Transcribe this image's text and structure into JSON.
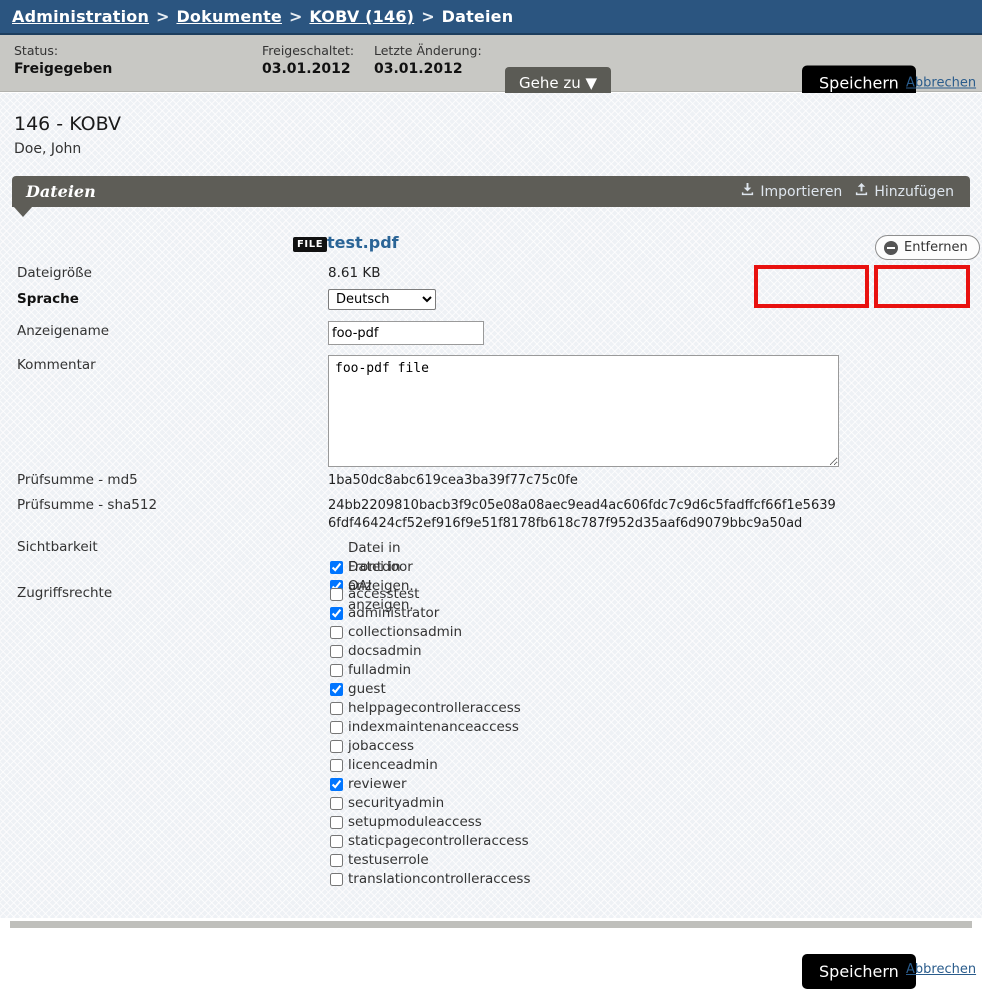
{
  "breadcrumb": {
    "items": [
      {
        "label": "Administration",
        "link": true
      },
      {
        "label": "Dokumente",
        "link": true
      },
      {
        "label": "KOBV (146)",
        "link": true
      },
      {
        "label": "Dateien",
        "link": false
      }
    ],
    "separator": ">"
  },
  "statusbar": {
    "status_label": "Status:",
    "status_value": "Freigegeben",
    "published_label": "Freigeschaltet:",
    "published_value": "03.01.2012",
    "modified_label": "Letzte Änderung:",
    "modified_value": "03.01.2012",
    "goto_label": "Gehe zu ▼",
    "save_label": "Speichern",
    "cancel_label": "Abbrechen"
  },
  "document": {
    "title": "146 - KOBV",
    "author": "Doe, John"
  },
  "section": {
    "title": "Dateien",
    "import_label": "Importieren",
    "import_icon": "download-tray-icon",
    "add_label": "Hinzufügen",
    "add_icon": "upload-tray-icon"
  },
  "file": {
    "badge": "FILE",
    "name": "test.pdf",
    "remove_label": "Entfernen",
    "remove_icon": "minus-circle-icon"
  },
  "form": {
    "filesize_label": "Dateigröße",
    "filesize_value": "8.61 KB",
    "language_label": "Sprache",
    "language_value": "Deutsch",
    "language_options": [
      "Deutsch"
    ],
    "displayname_label": "Anzeigename",
    "displayname_value": "foo-pdf",
    "displayname_placeholder": "",
    "comment_label": "Kommentar",
    "comment_value": "foo-pdf file",
    "comment_placeholder": "",
    "md5_label": "Prüfsumme - md5",
    "md5_value": "1ba50dc8abc619cea3ba39f77c75c0fe",
    "sha512_label": "Prüfsumme - sha512",
    "sha512_value": "24bb2209810bacb3f9c05e08a08aec9ead4ac606fdc7c9d6c5fadffcf66f1e5639\n6fdf46424cf52ef916f9e51f8178fb618c787f952d35aaf6d9079bbc9a50ad",
    "visibility_label": "Sichtbarkeit",
    "visibility_options": [
      {
        "label": "Datei in Frontdoor anzeigen.",
        "checked": true
      },
      {
        "label": "Datei in OAI anzeigen.",
        "checked": true
      }
    ],
    "access_label": "Zugriffsrechte",
    "access_options": [
      {
        "label": "accesstest",
        "checked": false
      },
      {
        "label": "administrator",
        "checked": true
      },
      {
        "label": "collectionsadmin",
        "checked": false
      },
      {
        "label": "docsadmin",
        "checked": false
      },
      {
        "label": "fulladmin",
        "checked": false
      },
      {
        "label": "guest",
        "checked": true
      },
      {
        "label": "helppagecontrolleraccess",
        "checked": false
      },
      {
        "label": "indexmaintenanceaccess",
        "checked": false
      },
      {
        "label": "jobaccess",
        "checked": false
      },
      {
        "label": "licenceadmin",
        "checked": false
      },
      {
        "label": "reviewer",
        "checked": true
      },
      {
        "label": "securityadmin",
        "checked": false
      },
      {
        "label": "setupmoduleaccess",
        "checked": false
      },
      {
        "label": "staticpagecontrolleraccess",
        "checked": false
      },
      {
        "label": "testuserrole",
        "checked": false
      },
      {
        "label": "translationcontrolleraccess",
        "checked": false
      }
    ]
  },
  "footer": {
    "save_label": "Speichern",
    "cancel_label": "Abbrechen"
  },
  "colors": {
    "breadcrumb_bg": "#2b5580",
    "statusbar_bg": "#c8c8c4",
    "content_bg": "#eef1f5",
    "section_bg": "#5e5d57",
    "link": "#2a6496",
    "annotation": "#e8110f"
  }
}
